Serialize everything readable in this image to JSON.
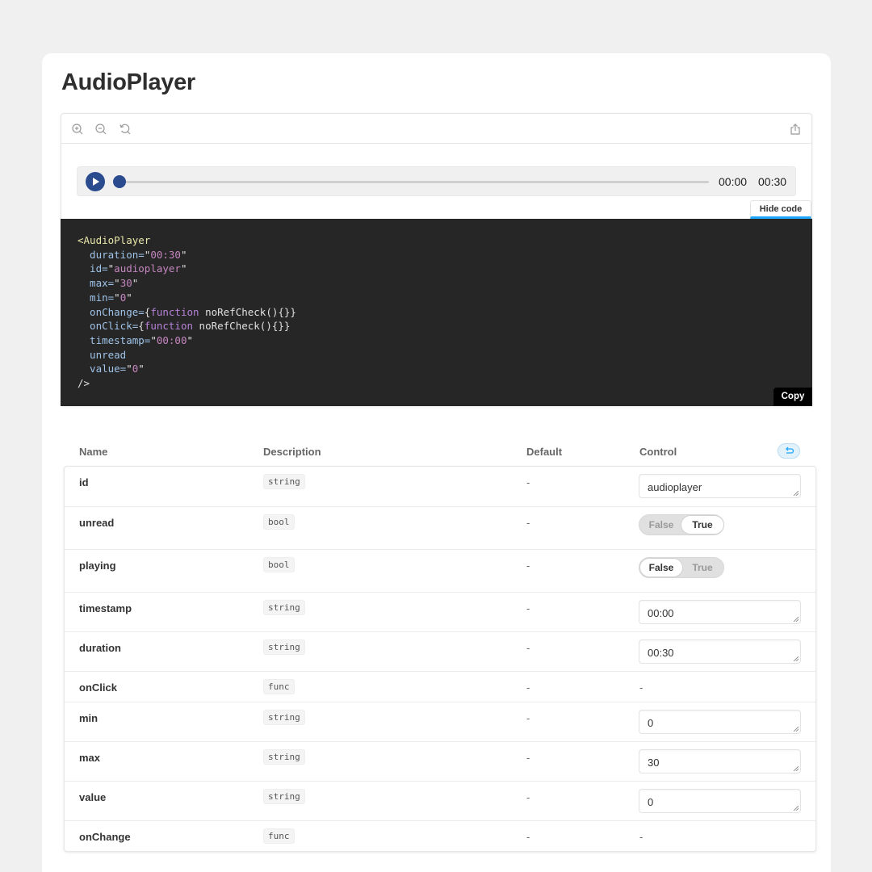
{
  "page": {
    "title": "AudioPlayer"
  },
  "toolbar": {
    "icons": [
      "zoom-in-icon",
      "zoom-out-icon",
      "reset-zoom-icon",
      "share-icon"
    ]
  },
  "player": {
    "timestamp": "00:00",
    "duration": "00:30",
    "progress_percent": 0,
    "playing": false
  },
  "code": {
    "hide_label": "Hide code",
    "copy_label": "Copy",
    "lines": [
      [
        {
          "t": "<AudioPlayer",
          "c": "tag"
        }
      ],
      [
        {
          "t": "  duration=",
          "c": "attr"
        },
        {
          "t": "\"",
          "c": "plain"
        },
        {
          "t": "00:30",
          "c": "str"
        },
        {
          "t": "\"",
          "c": "plain"
        }
      ],
      [
        {
          "t": "  id=",
          "c": "attr"
        },
        {
          "t": "\"",
          "c": "plain"
        },
        {
          "t": "audioplayer",
          "c": "str"
        },
        {
          "t": "\"",
          "c": "plain"
        }
      ],
      [
        {
          "t": "  max=",
          "c": "attr"
        },
        {
          "t": "\"",
          "c": "plain"
        },
        {
          "t": "30",
          "c": "str"
        },
        {
          "t": "\"",
          "c": "plain"
        }
      ],
      [
        {
          "t": "  min=",
          "c": "attr"
        },
        {
          "t": "\"",
          "c": "plain"
        },
        {
          "t": "0",
          "c": "str"
        },
        {
          "t": "\"",
          "c": "plain"
        }
      ],
      [
        {
          "t": "  onChange=",
          "c": "attr"
        },
        {
          "t": "{",
          "c": "plain"
        },
        {
          "t": "function",
          "c": "kw"
        },
        {
          "t": " noRefCheck(){}}",
          "c": "plain"
        }
      ],
      [
        {
          "t": "  onClick=",
          "c": "attr"
        },
        {
          "t": "{",
          "c": "plain"
        },
        {
          "t": "function",
          "c": "kw"
        },
        {
          "t": " noRefCheck(){}}",
          "c": "plain"
        }
      ],
      [
        {
          "t": "  timestamp=",
          "c": "attr"
        },
        {
          "t": "\"",
          "c": "plain"
        },
        {
          "t": "00:00",
          "c": "str"
        },
        {
          "t": "\"",
          "c": "plain"
        }
      ],
      [
        {
          "t": "  unread",
          "c": "attr"
        }
      ],
      [
        {
          "t": "  value=",
          "c": "attr"
        },
        {
          "t": "\"",
          "c": "plain"
        },
        {
          "t": "0",
          "c": "str"
        },
        {
          "t": "\"",
          "c": "plain"
        }
      ],
      [
        {
          "t": "/>",
          "c": "plain"
        }
      ]
    ]
  },
  "props": {
    "headers": {
      "name": "Name",
      "description": "Description",
      "default": "Default",
      "control": "Control"
    },
    "rows": [
      {
        "name": "id",
        "type": "string",
        "default": "-",
        "control": "text",
        "value": "audioplayer"
      },
      {
        "name": "unread",
        "type": "bool",
        "default": "-",
        "control": "toggle",
        "value": true
      },
      {
        "name": "playing",
        "type": "bool",
        "default": "-",
        "control": "toggle",
        "value": false
      },
      {
        "name": "timestamp",
        "type": "string",
        "default": "-",
        "control": "text",
        "value": "00:00"
      },
      {
        "name": "duration",
        "type": "string",
        "default": "-",
        "control": "text",
        "value": "00:30"
      },
      {
        "name": "onClick",
        "type": "func",
        "default": "-",
        "control": "none",
        "value": "-"
      },
      {
        "name": "min",
        "type": "string",
        "default": "-",
        "control": "text",
        "value": "0"
      },
      {
        "name": "max",
        "type": "string",
        "default": "-",
        "control": "text",
        "value": "30"
      },
      {
        "name": "value",
        "type": "string",
        "default": "-",
        "control": "text",
        "value": "0"
      },
      {
        "name": "onChange",
        "type": "func",
        "default": "-",
        "control": "none",
        "value": "-"
      }
    ],
    "toggle_labels": {
      "false": "False",
      "true": "True"
    }
  }
}
